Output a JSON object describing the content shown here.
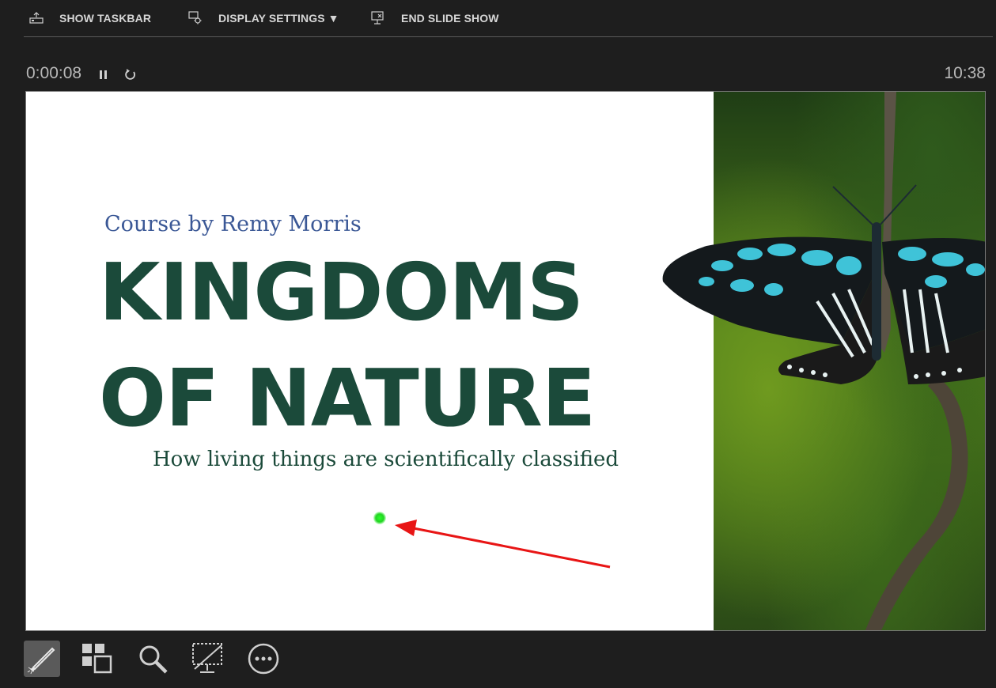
{
  "toolbar": {
    "show_taskbar": "SHOW TASKBAR",
    "display_settings": "DISPLAY SETTINGS ▼",
    "end_slide_show": "END SLIDE SHOW"
  },
  "presenter": {
    "elapsed_time": "0:00:08",
    "clock": "10:38"
  },
  "slide": {
    "course": "Course by Remy Morris",
    "title_line1": "KINGDOMS",
    "title_line2": "OF NATURE",
    "subtitle": "How living things are scientifically classified"
  },
  "bottom_tools": {
    "pen_tool": "pen-laser-icon",
    "see_all_slides": "grid-slides-icon",
    "zoom": "magnifier-icon",
    "black_screen": "screen-off-icon",
    "more_options": "more-options-icon"
  },
  "colors": {
    "background": "#1e1e1e",
    "title_green": "#1b4a3a",
    "course_blue": "#3b5896",
    "laser_green": "#23d423",
    "arrow_red": "#e81515"
  }
}
